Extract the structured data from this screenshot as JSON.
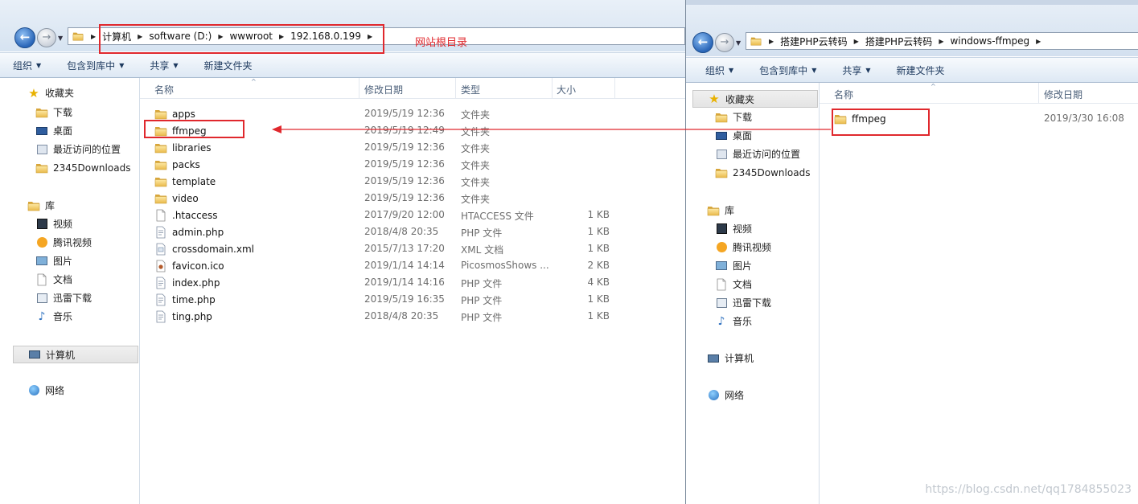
{
  "left_window": {
    "address_segments": [
      "计算机",
      "software (D:)",
      "wwwroot",
      "192.168.0.199"
    ],
    "toolbar": {
      "organize": "组织",
      "include_in_library": "包含到库中",
      "share": "共享",
      "new_folder": "新建文件夹"
    },
    "nav": {
      "favorites": "收藏夹",
      "favorites_items": [
        "下载",
        "桌面",
        "最近访问的位置",
        "2345Downloads"
      ],
      "libraries": "库",
      "library_items": [
        "视频",
        "腾讯视频",
        "图片",
        "文档",
        "迅雷下载",
        "音乐"
      ],
      "computer": "计算机",
      "network": "网络"
    },
    "columns": {
      "name": "名称",
      "modified": "修改日期",
      "type": "类型",
      "size": "大小"
    },
    "files": [
      {
        "name": "apps",
        "date": "2019/5/19 12:36",
        "type": "文件夹",
        "size": "",
        "icon": "folder-icon"
      },
      {
        "name": "ffmpeg",
        "date": "2019/5/19 12:49",
        "type": "文件夹",
        "size": "",
        "icon": "folder-icon"
      },
      {
        "name": "libraries",
        "date": "2019/5/19 12:36",
        "type": "文件夹",
        "size": "",
        "icon": "folder-icon"
      },
      {
        "name": "packs",
        "date": "2019/5/19 12:36",
        "type": "文件夹",
        "size": "",
        "icon": "folder-icon"
      },
      {
        "name": "template",
        "date": "2019/5/19 12:36",
        "type": "文件夹",
        "size": "",
        "icon": "folder-icon"
      },
      {
        "name": "video",
        "date": "2019/5/19 12:36",
        "type": "文件夹",
        "size": "",
        "icon": "folder-icon"
      },
      {
        "name": ".htaccess",
        "date": "2017/9/20 12:00",
        "type": "HTACCESS 文件",
        "size": "1 KB",
        "icon": "file-icon"
      },
      {
        "name": "admin.php",
        "date": "2018/4/8 20:35",
        "type": "PHP 文件",
        "size": "1 KB",
        "icon": "php-file-icon"
      },
      {
        "name": "crossdomain.xml",
        "date": "2015/7/13 17:20",
        "type": "XML 文档",
        "size": "1 KB",
        "icon": "xml-file-icon"
      },
      {
        "name": "favicon.ico",
        "date": "2019/1/14 14:14",
        "type": "PicosmosShows ...",
        "size": "2 KB",
        "icon": "ico-file-icon"
      },
      {
        "name": "index.php",
        "date": "2019/1/14 14:16",
        "type": "PHP 文件",
        "size": "4 KB",
        "icon": "php-file-icon"
      },
      {
        "name": "time.php",
        "date": "2019/5/19 16:35",
        "type": "PHP 文件",
        "size": "1 KB",
        "icon": "php-file-icon"
      },
      {
        "name": "ting.php",
        "date": "2018/4/8 20:35",
        "type": "PHP 文件",
        "size": "1 KB",
        "icon": "php-file-icon"
      }
    ]
  },
  "right_window": {
    "address_segments": [
      "搭建PHP云转码",
      "搭建PHP云转码",
      "windows-ffmpeg"
    ],
    "toolbar": {
      "organize": "组织",
      "include_in_library": "包含到库中",
      "share": "共享",
      "new_folder": "新建文件夹"
    },
    "nav": {
      "favorites": "收藏夹",
      "favorites_items": [
        "下载",
        "桌面",
        "最近访问的位置",
        "2345Downloads"
      ],
      "libraries": "库",
      "library_items": [
        "视频",
        "腾讯视频",
        "图片",
        "文档",
        "迅雷下载",
        "音乐"
      ],
      "computer": "计算机",
      "network": "网络"
    },
    "columns": {
      "name": "名称",
      "modified": "修改日期"
    },
    "files": [
      {
        "name": "ffmpeg",
        "date": "2019/3/30 16:08",
        "icon": "folder-icon"
      }
    ]
  },
  "annotation": {
    "label": "网站根目录",
    "color": "#e0282d"
  },
  "watermark": "https://blog.csdn.net/qq1784855023"
}
